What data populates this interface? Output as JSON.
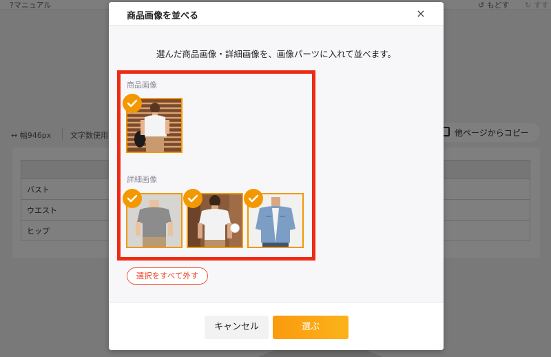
{
  "background": {
    "manual_label": "?マニュアル",
    "undo_label": "もどす",
    "redo_label": "すす",
    "width_label": "幅946px",
    "chars_label": "文字数使用",
    "copy_button_label": "他ページからコピー",
    "table_rows": [
      "",
      "バスト",
      "ウエスト",
      "ヒップ"
    ]
  },
  "modal": {
    "title": "商品画像を並べる",
    "close_icon": "×",
    "instruction": "選んだ商品画像・詳細画像を、画像パーツに入れて並べます。",
    "sections": {
      "main": {
        "label": "商品画像"
      },
      "detail": {
        "label": "詳細画像"
      }
    },
    "deselect_label": "選択をすべて外す",
    "cancel_label": "キャンセル",
    "select_label": "選ぶ"
  },
  "colors": {
    "accent": "#f39800",
    "highlight_frame": "#ee2a15",
    "deselect": "#e8472a"
  }
}
